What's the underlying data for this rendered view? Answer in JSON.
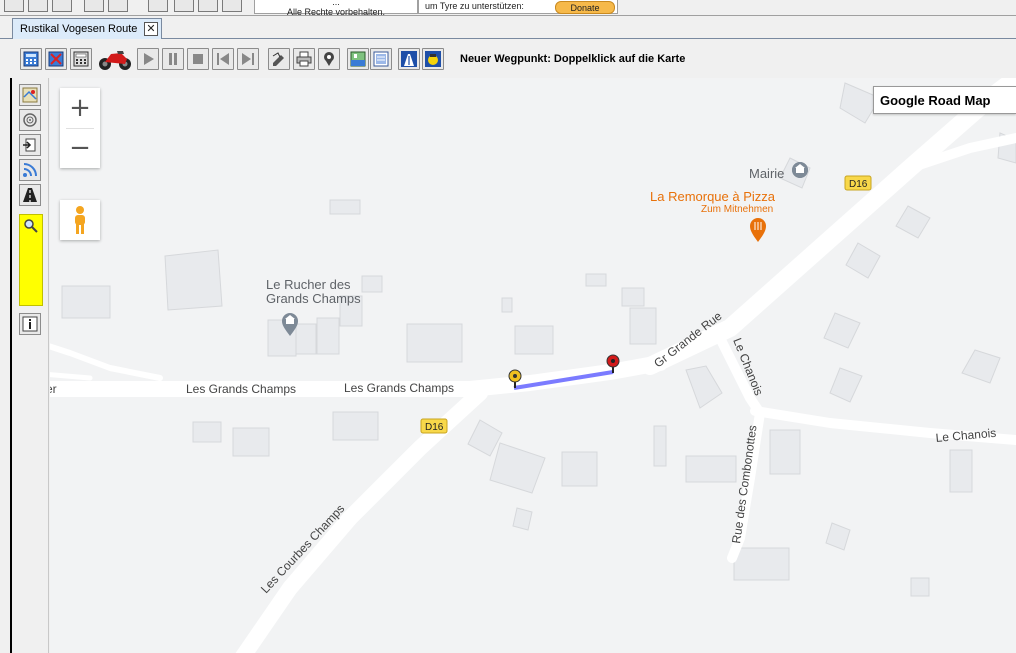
{
  "top_strip": {
    "copyright_line1": "...",
    "copyright_line2": "Alle Rechte vorbehalten.",
    "support_text": "um Tyre zu unterstützen:",
    "donate_label": "Donate"
  },
  "tab": {
    "label": "Rustikal Vogesen Route",
    "close_label": "✕"
  },
  "toolbar": {
    "status_text": "Neuer Wegpunkt: Doppelklick auf die Karte",
    "buttons": [
      "calculator-icon",
      "red-calculator-icon",
      "grid-calculator-icon",
      "motorcycle-icon",
      "play-icon",
      "pause-icon",
      "stop-icon",
      "skip-back-icon",
      "skip-forward-icon",
      "edit-route-icon",
      "print-icon",
      "waypoint-icon",
      "map-view-icon",
      "list-view-icon",
      "highway-icon",
      "avoid-icon"
    ]
  },
  "sidebar": {
    "buttons": [
      "map-layers-icon",
      "target-icon",
      "export-icon",
      "rss-icon",
      "road-icon",
      "search-icon",
      "info-icon"
    ]
  },
  "map": {
    "zoom_in": "+",
    "zoom_out": "−",
    "map_type": "Google Road Map",
    "streets": {
      "les_grands_champs_1": "Les Grands Champs",
      "les_grands_champs_2": "Les Grands Champs",
      "les_grands_champs_edge": "er",
      "gr_grande_rue": "Gr Grande Rue",
      "le_chanois_vertical": "Le Chanois",
      "le_chanois": "Le Chanois",
      "rue_des_combonottes": "Rue des Combonottes",
      "les_courbes_champs": "Les Courbes Champs"
    },
    "route_shields": {
      "d16_left": "D16",
      "d16_right": "D16"
    },
    "pois": {
      "mairie": "Mairie",
      "remorque_title": "La Remorque à Pizza",
      "remorque_sub": "Zum Mitnehmen",
      "rucher_line1": "Le Rucher des",
      "rucher_line2": "Grands Champs"
    },
    "colors": {
      "route_line": "#7b7bff",
      "poi_orange": "#e8710a",
      "poi_gray": "#7e8a97",
      "shield": "#f8d84a"
    }
  }
}
